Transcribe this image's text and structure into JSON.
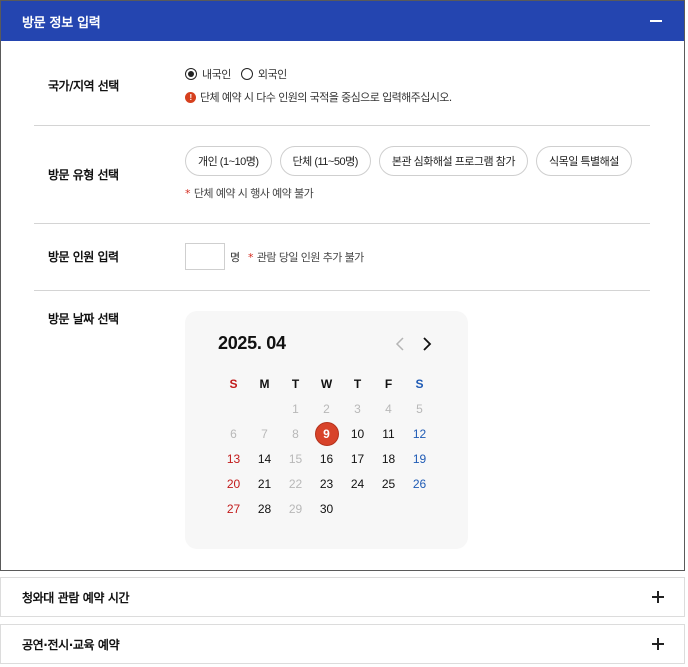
{
  "panel": {
    "title": "방문 정보 입력"
  },
  "nationality": {
    "label": "국가/지역 선택",
    "options": [
      {
        "label": "내국인",
        "checked": true
      },
      {
        "label": "외국인",
        "checked": false
      }
    ],
    "notice": "단체 예약 시 다수 인원의 국적을 중심으로 입력해주십시오.",
    "notice_icon": "info-icon"
  },
  "visit_type": {
    "label": "방문 유형 선택",
    "buttons": [
      "개인 (1~10명)",
      "단체 (11~50명)",
      "본관 심화해설 프로그램 참가",
      "식목일 특별해설"
    ],
    "note": "단체 예약 시 행사 예약 불가"
  },
  "headcount": {
    "label": "방문 인원 입력",
    "value": "",
    "unit": "명",
    "note": "관람 당일 인원 추가 불가"
  },
  "date": {
    "label": "방문 날짜 선택",
    "calendar": {
      "title": "2025. 04",
      "weekdays": [
        "S",
        "M",
        "T",
        "W",
        "T",
        "F",
        "S"
      ],
      "leading_blanks": 2,
      "days": 30,
      "disabled_until": 8,
      "selected": 9,
      "colors": {
        "sunday": "#c21b1b",
        "saturday": "#1f5bb5",
        "selected": "#d8432a",
        "disabled": "#b8b8b8"
      }
    }
  },
  "sections": [
    {
      "title": "청와대 관람 예약 시간"
    },
    {
      "title": "공연·전시·교육 예약"
    }
  ],
  "colors": {
    "header": "#2445b0",
    "accent": "#d42a1f"
  }
}
